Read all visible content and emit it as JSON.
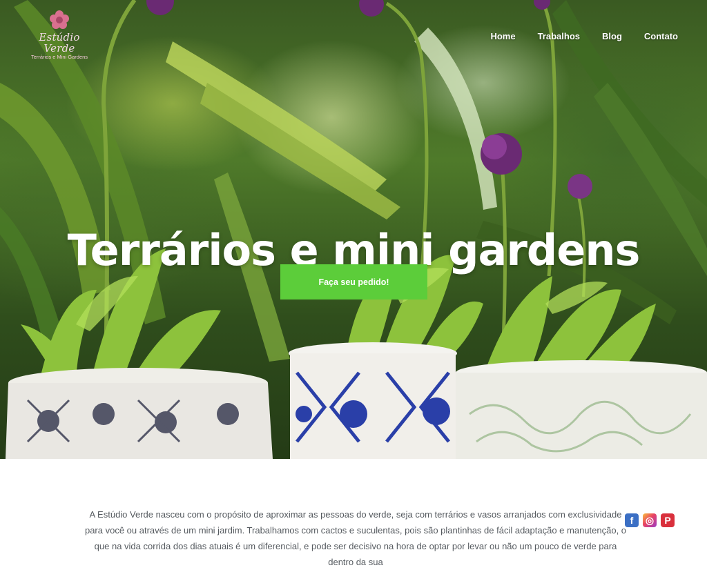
{
  "logo": {
    "brand": "Estúdio Verde",
    "tagline": "Terrários e Mini Gardens",
    "icon": "flower-icon"
  },
  "nav": {
    "items": [
      {
        "label": "Home"
      },
      {
        "label": "Trabalhos"
      },
      {
        "label": "Blog"
      },
      {
        "label": "Contato"
      }
    ]
  },
  "hero": {
    "headline": "Terrários e mini gardens",
    "cta_label": "Faça seu pedido!",
    "cta_color": "#5ccd3a"
  },
  "about": {
    "text": "A Estúdio Verde nasceu com o propósito de aproximar as pessoas do verde, seja com terrários e vasos arranjados com exclusividade para você ou através de um mini jardim. Trabalhamos com cactos e suculentas, pois são plantinhas  de fácil adaptação e manutenção, o que na vida corrida dos dias atuais é um diferencial, e pode ser decisivo na hora de optar por levar ou não um pouco de verde para dentro da sua"
  },
  "social": [
    {
      "icon": "facebook-icon",
      "glyph": "f"
    },
    {
      "icon": "instagram-icon",
      "glyph": "◎"
    },
    {
      "icon": "pinterest-icon",
      "glyph": "P"
    }
  ]
}
